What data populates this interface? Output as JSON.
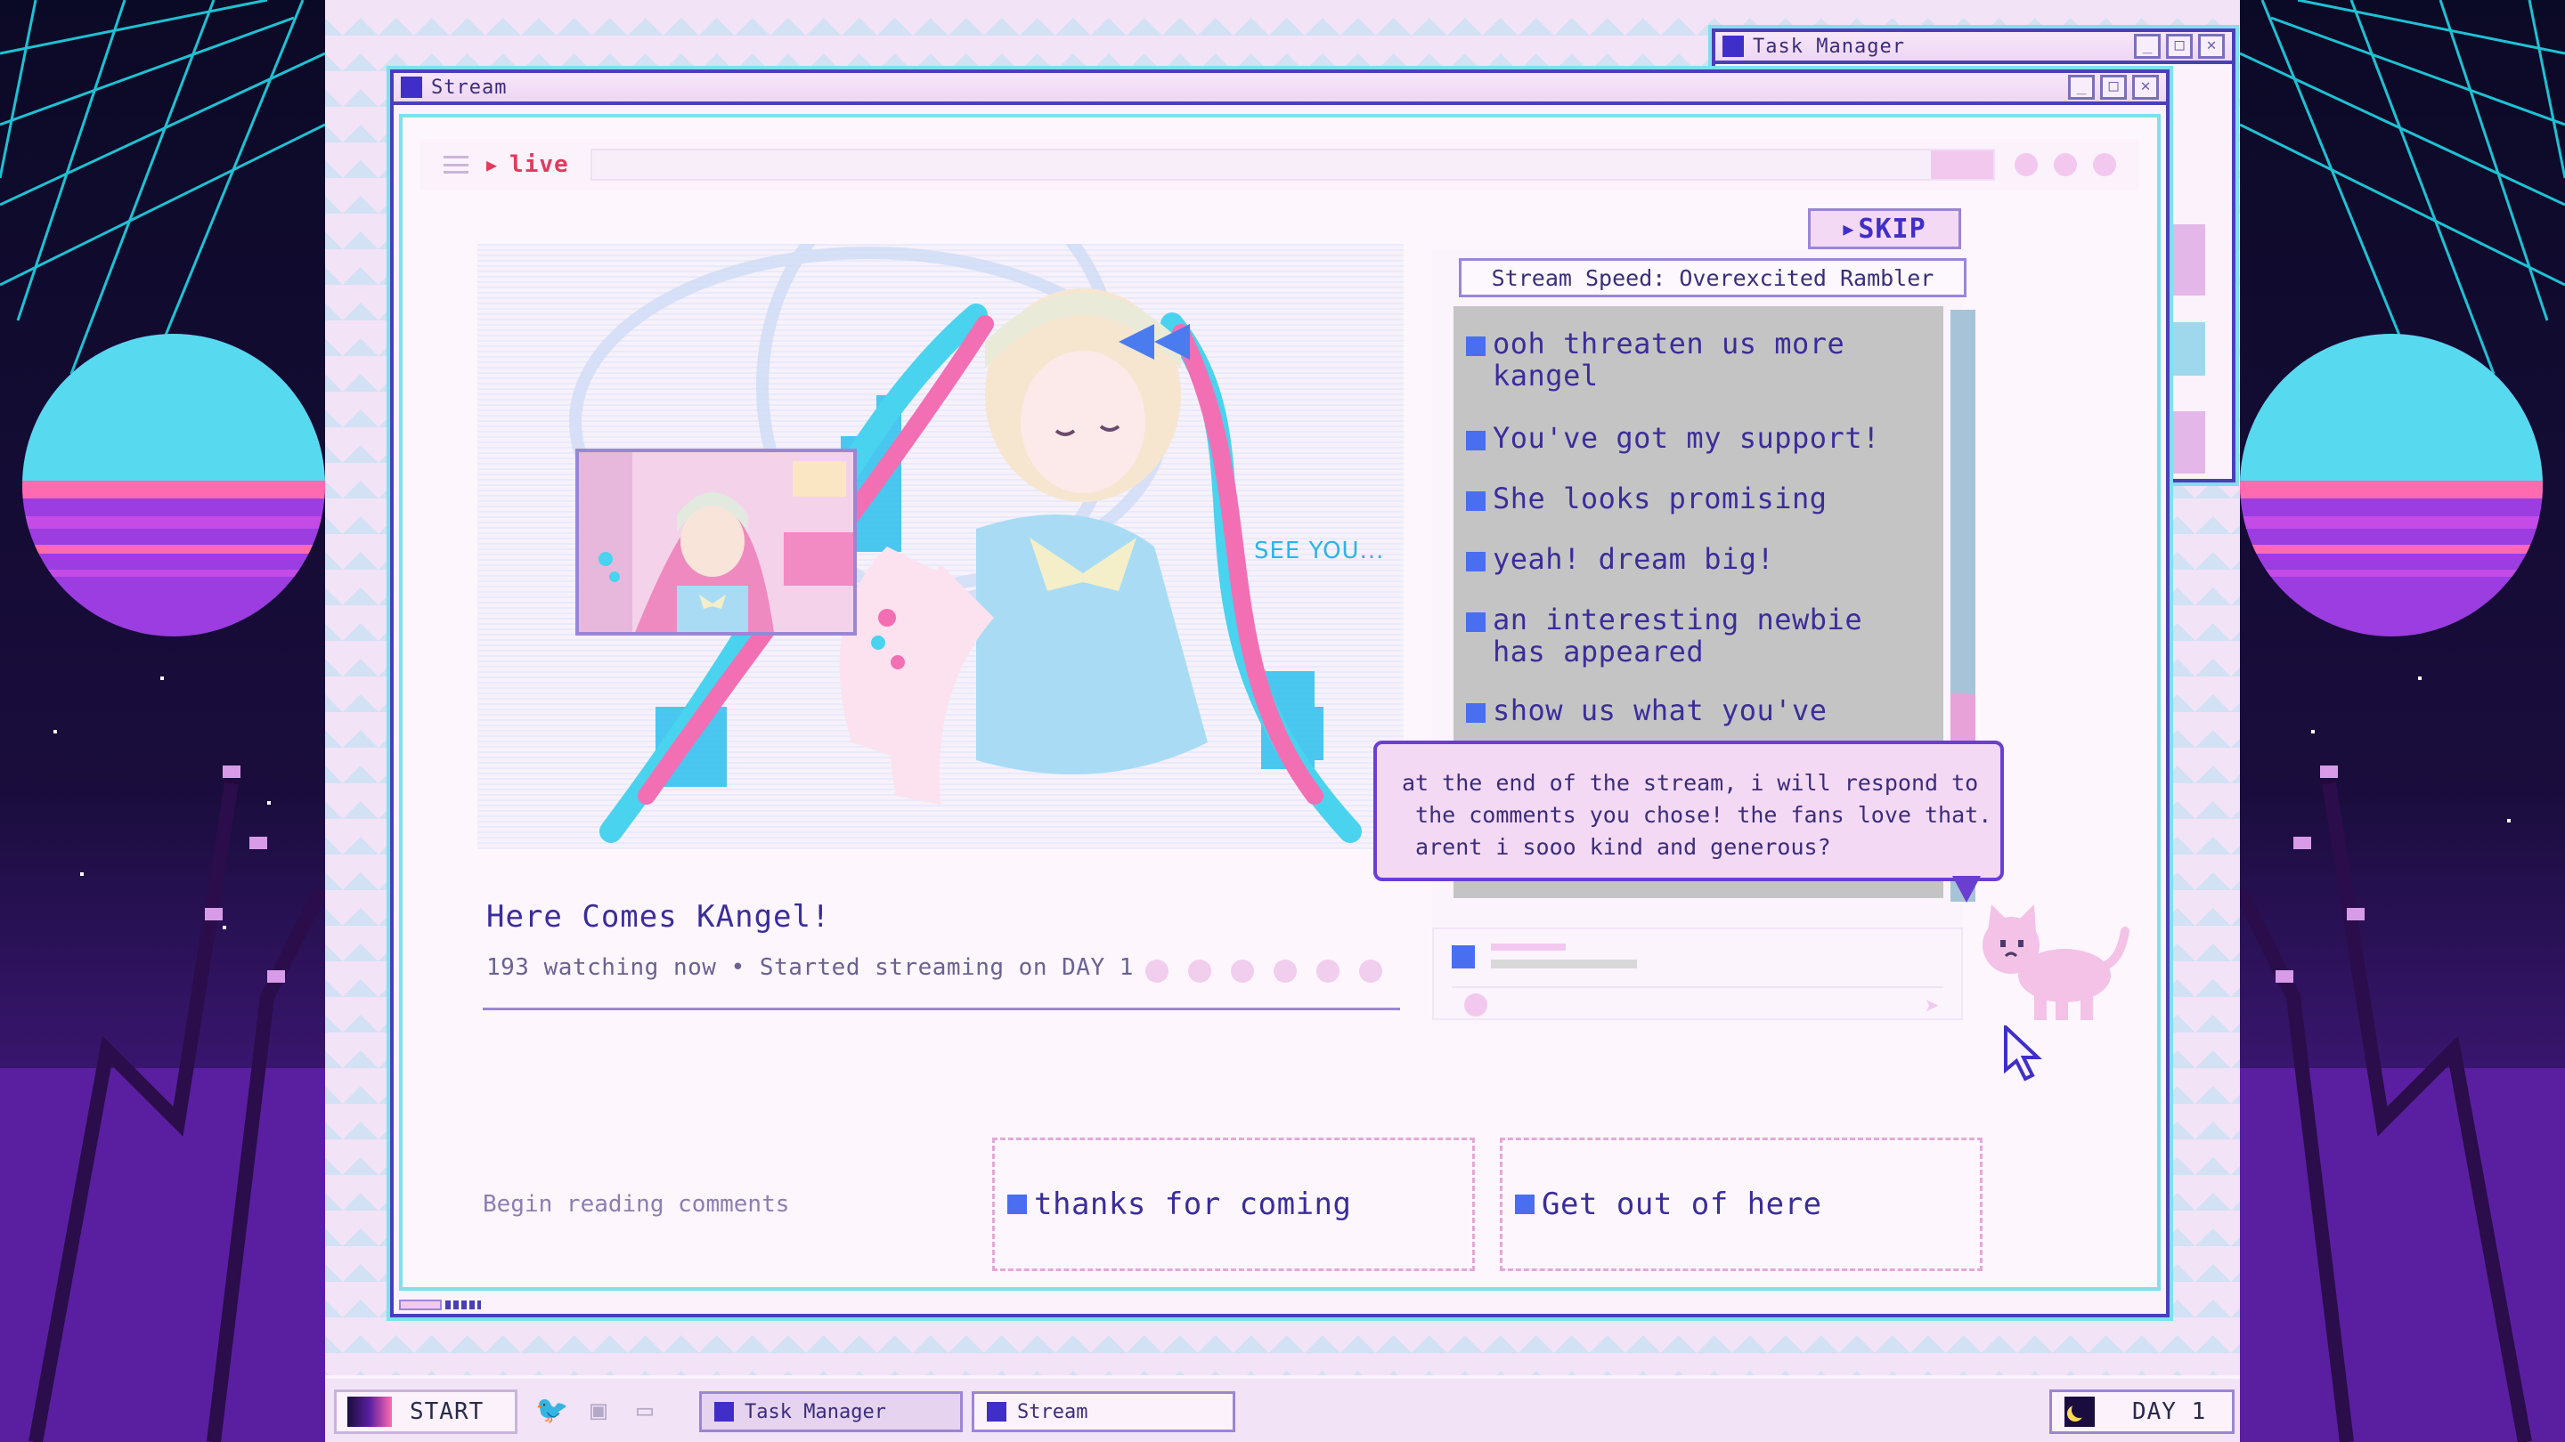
{
  "windows": {
    "task_manager": {
      "title": "Task Manager"
    },
    "stream": {
      "title": "Stream"
    }
  },
  "stream": {
    "live_label": "live",
    "skip_label": "SKIP",
    "overlay_text": "SEE YOU...",
    "title": "Here Comes KAngel!",
    "meta": "193 watching now  •  Started streaming on DAY 1",
    "speed_label": "Stream Speed: Overexcited Rambler",
    "comments": [
      {
        "text": "ooh threaten us more\nkangel"
      },
      {
        "text": "You've got my support!"
      },
      {
        "text": "She looks promising"
      },
      {
        "text": "yeah! dream big!"
      },
      {
        "text": "an interesting newbie\nhas appeared"
      },
      {
        "text": "show us what you've"
      }
    ],
    "tooltip": "at the end of the stream, i will respond to\n the comments you chose! the fans love that.\n arent i sooo kind and generous?",
    "begin_label": "Begin reading comments",
    "replies": [
      {
        "text": "thanks for coming"
      },
      {
        "text": "Get out of here"
      }
    ]
  },
  "taskbar": {
    "start_label": "START",
    "icons": [
      "twitter-icon",
      "chat-icon",
      "computer-icon"
    ],
    "tasks": [
      {
        "label": "Task Manager"
      },
      {
        "label": "Stream"
      }
    ],
    "day_label": "DAY 1"
  },
  "colors": {
    "accent": "#3f2fc8",
    "live_red": "#e23a5c",
    "window_border": "#4a3fb8",
    "cyan": "#7fe0ee",
    "pink": "#f3c8ef"
  }
}
